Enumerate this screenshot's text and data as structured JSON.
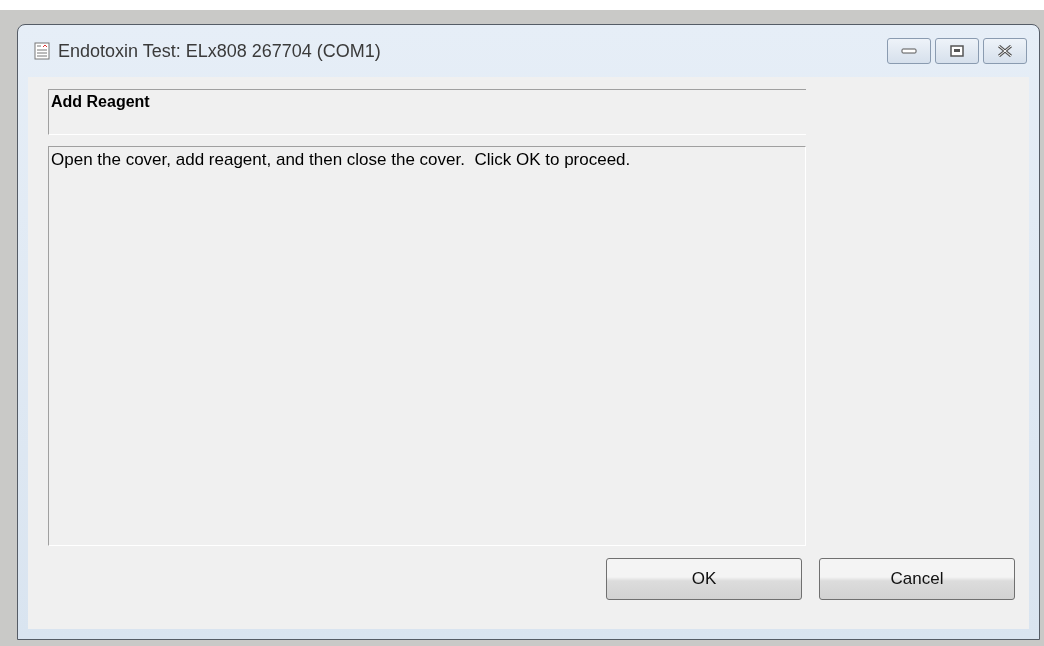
{
  "window": {
    "title": "Endotoxin Test: ELx808 267704 (COM1)"
  },
  "header": "Add Reagent",
  "message": "Open the cover, add reagent, and then close the cover.  Click OK to proceed.",
  "buttons": [
    {
      "label": "OK"
    },
    {
      "label": "Cancel"
    }
  ]
}
